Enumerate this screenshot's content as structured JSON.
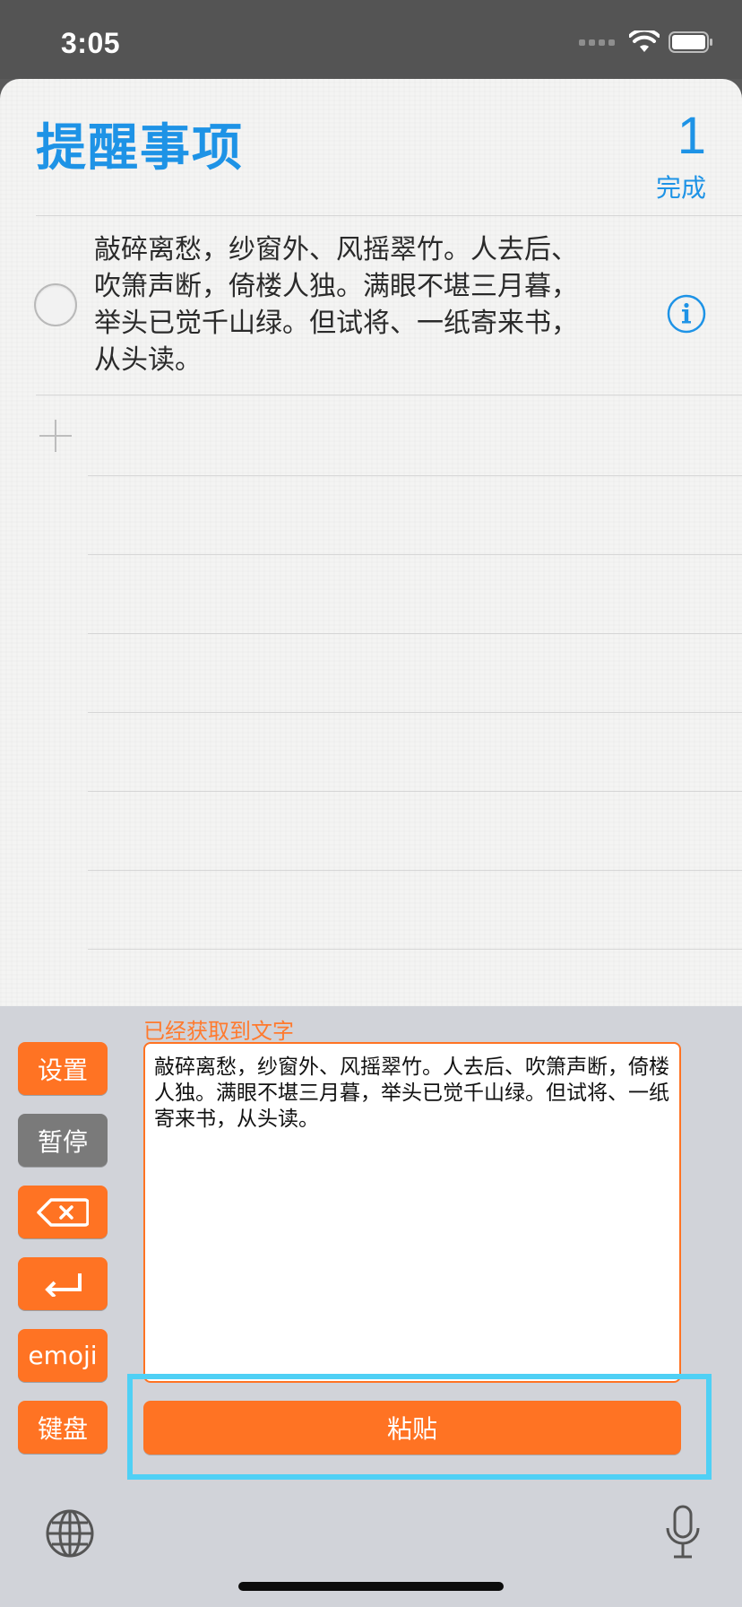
{
  "status": {
    "time": "3:05"
  },
  "header": {
    "title": "提醒事项",
    "count": "1",
    "count_label": "完成"
  },
  "reminders": [
    {
      "text": "敲碎离愁，纱窗外、风摇翠竹。人去后、吹箫声断，倚楼人独。满眼不堪三月暮，举头已觉千山绿。但试将、一纸寄来书，从头读。"
    }
  ],
  "keyboard": {
    "label": "已经获取到文字",
    "buttons": {
      "settings": "设置",
      "pause": "暂停",
      "emoji": "emoji",
      "keyboard": "键盘"
    },
    "textarea": "敲碎离愁，纱窗外、风摇翠竹。人去后、吹箫声断，倚楼人独。满眼不堪三月暮，举头已觉千山绿。但试将、一纸寄来书，从头读。",
    "paste": "粘贴"
  },
  "colors": {
    "accent_blue": "#1e93e6",
    "accent_orange": "#ff7323",
    "highlight": "#4fd0f5"
  }
}
